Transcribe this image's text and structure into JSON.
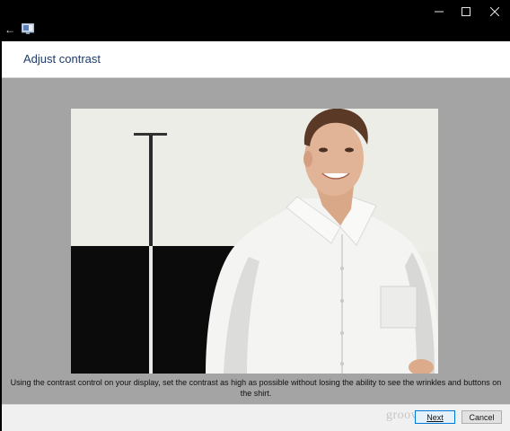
{
  "window": {
    "back_glyph": "←",
    "minimize_glyph": "—",
    "maximize_glyph": "☐",
    "close_glyph": "✕"
  },
  "header": {
    "title": "Adjust contrast"
  },
  "content": {
    "image_subject": "man-in-white-shirt",
    "instruction": "Using the contrast control on your display, set the contrast as high as possible without losing the ability to see the wrinkles and buttons on the shirt."
  },
  "footer": {
    "watermark": "groovyPost",
    "next_label": "Next",
    "cancel_label": "Cancel"
  },
  "colors": {
    "title_text": "#1c3b6e",
    "content_bg": "#a4a4a4",
    "accent_border": "#0078d7"
  }
}
